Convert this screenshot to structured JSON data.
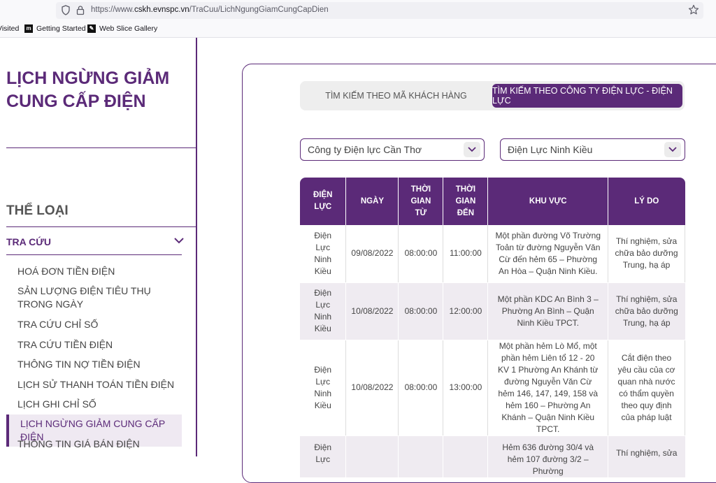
{
  "browser": {
    "url_prefix": "https://www.",
    "url_host": "cskh.evnspc.vn",
    "url_path": "/TraCuu/LichNgungGiamCungCapDien",
    "bookmarks": [
      "Visited",
      "Getting Started",
      "Web Slice Gallery"
    ]
  },
  "sidebar": {
    "title": "LỊCH NGỪNG GIẢM CUNG CẤP ĐIỆN",
    "category_heading": "THỂ LOẠI",
    "accordion_label": "TRA CỨU",
    "items": [
      "HOÁ ĐƠN TIỀN ĐIỆN",
      "SẢN LƯỢNG ĐIỆN TIÊU THỤ TRONG NGÀY",
      "TRA CỨU CHỈ SỐ",
      "TRA CỨU TIỀN ĐIỆN",
      "THÔNG TIN NỢ TIỀN ĐIỆN",
      "LỊCH SỬ THANH TOÁN TIỀN ĐIỆN",
      "LỊCH GHI CHỈ SỐ",
      "LỊCH NGỪNG GIẢM CUNG CẤP ĐIỆN",
      "THÔNG TIN GIÁ BÁN ĐIỆN"
    ],
    "active_index": 7
  },
  "tabs": {
    "by_customer": "TÌM KIẾM THEO MÃ KHÁCH HÀNG",
    "by_company": "TÌM KIẾM THEO CÔNG TY ĐIỆN LỰC - ĐIỆN LỰC"
  },
  "filters": {
    "company": "Công ty Điện lực Cần Thơ",
    "branch": "Điện Lực Ninh Kiều"
  },
  "table": {
    "headers": [
      "ĐIỆN LỰC",
      "NGÀY",
      "THỜI GIAN TỪ",
      "THỜI GIAN ĐẾN",
      "KHU VỰC",
      "LÝ DO"
    ],
    "rows": [
      [
        "Điện Lực Ninh Kiều",
        "09/08/2022",
        "08:00:00",
        "11:00:00",
        "Một phần đường Võ Trường Toản từ đường Nguyễn Văn Cừ đến hẻm 65 – Phường An Hòa – Quận Ninh Kiều.",
        "Thí nghiệm, sửa chữa bảo dưỡng Trung, hạ áp"
      ],
      [
        "Điện Lực Ninh Kiều",
        "10/08/2022",
        "08:00:00",
        "12:00:00",
        "Một phần KDC An Bình 3 – Phường An Bình – Quận Ninh Kiều TPCT.",
        "Thí nghiệm, sửa chữa bảo dưỡng Trung, hạ áp"
      ],
      [
        "Điện Lực Ninh Kiều",
        "10/08/2022",
        "08:00:00",
        "13:00:00",
        "Một phần hẻm Lò Mổ, một phần hẻm Liên tổ 12 - 20 KV 1 Phường An Khánh từ đường Nguyễn Văn Cừ hẻm 146, 147, 149, 158 và hẻm 160 – Phường An Khánh – Quận Ninh Kiều TPCT.",
        "Cắt điện theo yêu cầu của cơ quan nhà nước có thẩm quyền theo quy định của pháp luật"
      ],
      [
        "Điện Lực",
        "",
        "",
        "",
        "Hẻm 636 đường 30/4 và hẻm 107 đường 3/2 – Phường",
        "Thí nghiệm, sửa"
      ]
    ]
  }
}
